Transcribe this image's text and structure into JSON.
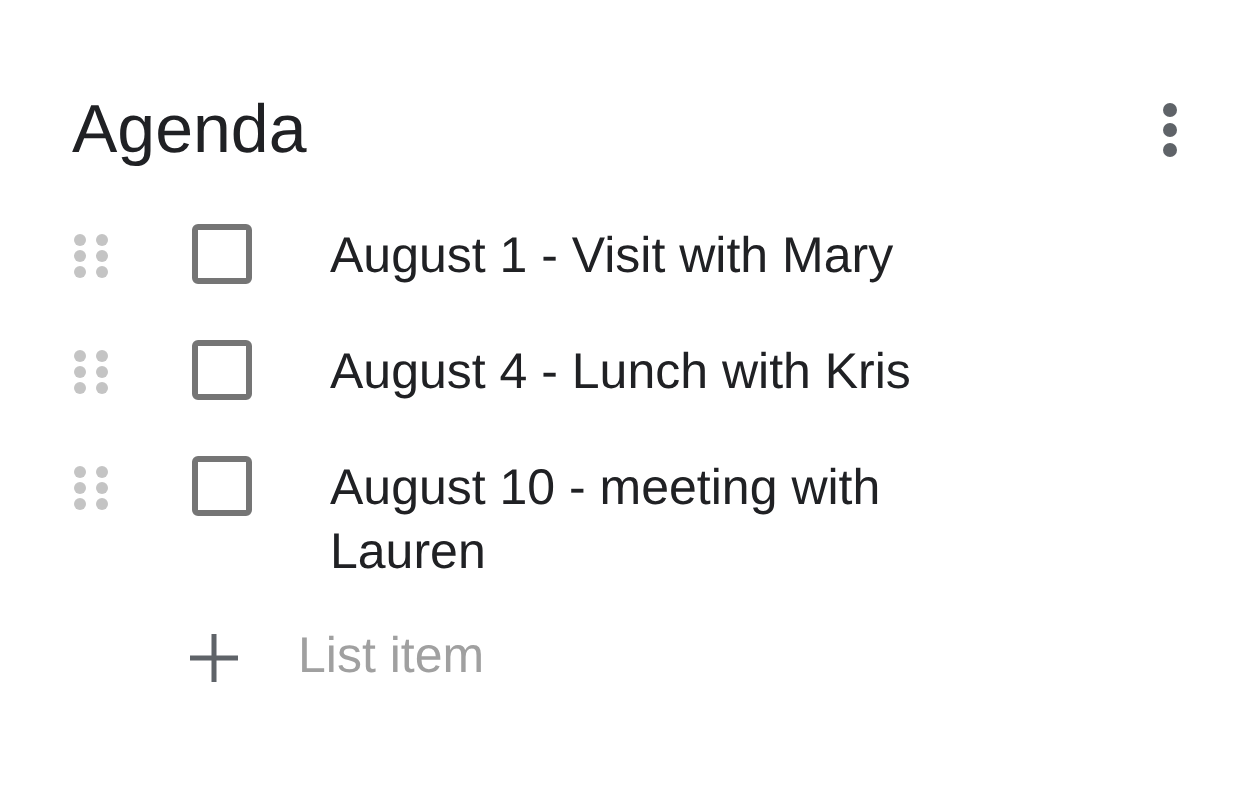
{
  "title": "Agenda",
  "items": [
    {
      "text": "August 1 - Visit with Mary",
      "checked": false
    },
    {
      "text": "August 4 - Lunch with Kris",
      "checked": false
    },
    {
      "text": "August 10 - meeting with Lauren",
      "checked": false
    }
  ],
  "new_item": {
    "placeholder": "List item"
  }
}
